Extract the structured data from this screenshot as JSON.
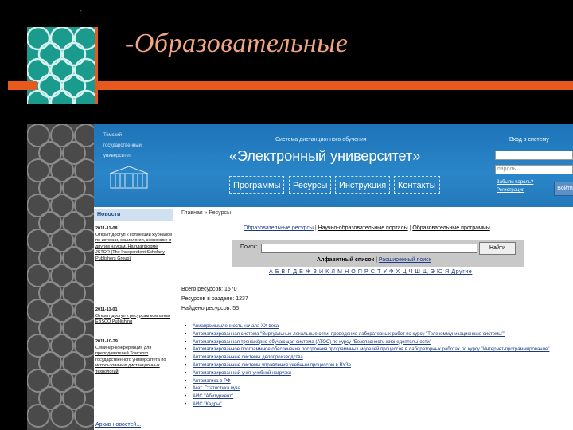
{
  "slide": {
    "title": "-Образовательные",
    "corner_mark": "*"
  },
  "site": {
    "university_name": [
      "Томский",
      "государственный",
      "университет"
    ],
    "system_subtitle": "Система дистанционного обучения",
    "system_title": "«Электронный университет»",
    "nav": [
      "Программы",
      "Ресурсы",
      "Инструкция",
      "Контакты"
    ],
    "login": {
      "title": "Вход в систему",
      "login_placeholder": "",
      "password_placeholder": "пароль",
      "forgot_link": "Забыли пароль?",
      "register_link": "Регистрация",
      "button": "Войти"
    }
  },
  "news": {
    "header": "Новости",
    "entries": [
      {
        "date": "2011-11-08",
        "text": "Открыт доступ к коллекции журналов по истории, социологии, экономике и другим наукам. На платформе JSTOR (The Independent Scholarly Publishers Group)"
      },
      {
        "date": "2011-11-01",
        "text": "Открыт доступ к ресурсам компании EBSCO Publishing"
      },
      {
        "date": "2011-10-29",
        "text": "Семинар-конференция для преподавателей Томского государственного университета по использованию дистанционных технологий"
      }
    ],
    "archive_link": "Архив новостей..."
  },
  "content": {
    "breadcrumb": "Главная » Ресурсы",
    "tabs": [
      "Образовательные ресурсы",
      "Научно-образовательные порталы",
      "Образовательные программы"
    ],
    "search": {
      "label": "Поиск:",
      "button": "Найти",
      "alpha_link": "Алфавитный список",
      "ext_link": "Расширенный поиск"
    },
    "alphabet": "А Б В Г Д Е Ж З И К Л М Н О П Р С Т У Ф Х Ц Ч Ш Щ Э Ю Я Другие",
    "stats": [
      "Всего ресурсов: 1570",
      "Ресурсов в разделе: 1237",
      "Найдено ресурсов: 55"
    ],
    "resources": [
      "Авиапромышленность начала XX века",
      "Автоматизированная система \"Виртуальные локальные сети: проведение лабораторных работ по курсу \"Телекоммуникационные системы\"\"",
      "Автоматизированная тренажёрно-обучающая система (АТОС) по курсу \"Безопасность жизнедеятельности\"",
      "Автоматизированное программное обеспечение построения программных моделей процессов в лабораторных работах по курсу \"Интернет-программирование\"",
      "Автоматизированные системы делопроизводства",
      "Автоматизированные системы управления учебным процессом в ВУЗе",
      "Автоматизированный учёт учебной нагрузки",
      "Автоматика в РФ",
      "Агат. Статистика вуза",
      "АИС \"Абитуриент\"",
      "АИС \"Кадры\""
    ]
  }
}
